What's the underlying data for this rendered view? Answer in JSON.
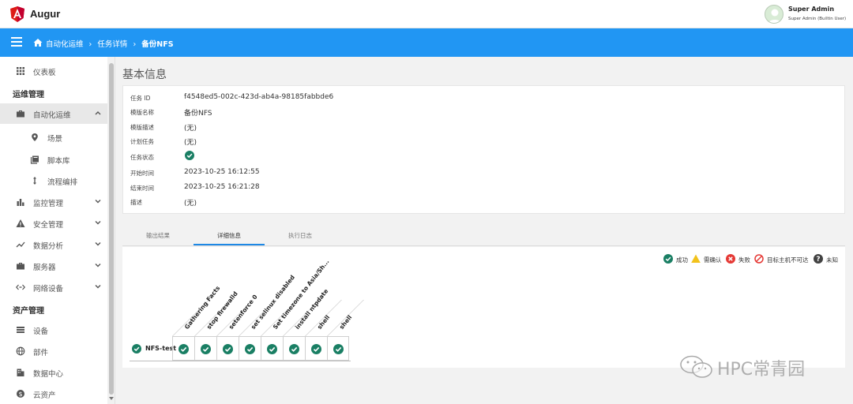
{
  "app": {
    "name": "Augur"
  },
  "user": {
    "name": "Super Admin",
    "role": "Super Admin (Builtin User)"
  },
  "breadcrumb": {
    "items": [
      "自动化运维",
      "任务详情",
      "备份NFS"
    ],
    "sep": "›"
  },
  "sidebar": {
    "dashboard": "仪表板",
    "sections": [
      "运维管理",
      "资产管理"
    ],
    "items": [
      {
        "label": "自动化运维",
        "icon": "briefcase-icon"
      },
      {
        "label": "场景",
        "icon": "location-pin-icon"
      },
      {
        "label": "脚本库",
        "icon": "book-icon"
      },
      {
        "label": "流程编排",
        "icon": "arrows-vertical-icon"
      },
      {
        "label": "监控管理",
        "icon": "bar-chart-icon"
      },
      {
        "label": "安全管理",
        "icon": "warning-icon"
      },
      {
        "label": "数据分析",
        "icon": "trend-line-icon"
      },
      {
        "label": "服务器",
        "icon": "briefcase-icon"
      },
      {
        "label": "网络设备",
        "icon": "code-arrows-icon"
      },
      {
        "label": "设备",
        "icon": "list-icon"
      },
      {
        "label": "部件",
        "icon": "globe-icon"
      },
      {
        "label": "数据中心",
        "icon": "building-icon"
      },
      {
        "label": "云资产",
        "icon": "dollar-circle-icon"
      }
    ]
  },
  "page": {
    "title": "基本信息"
  },
  "info": {
    "rows": [
      {
        "label": "任务 ID",
        "value": "f4548ed5-002c-423d-ab4a-98185fabbde6"
      },
      {
        "label": "模版名称",
        "value": "备份NFS"
      },
      {
        "label": "模版描述",
        "value": "(无)"
      },
      {
        "label": "计划任务",
        "value": "(无)"
      },
      {
        "label": "任务状态",
        "value": ""
      },
      {
        "label": "开始时间",
        "value": "2023-10-25 16:12:55"
      },
      {
        "label": "结束时间",
        "value": "2023-10-25 16:21:28"
      },
      {
        "label": "描述",
        "value": "(无)"
      }
    ],
    "status": "success"
  },
  "tabs": [
    {
      "label": "输出结果"
    },
    {
      "label": "详细信息",
      "active": true
    },
    {
      "label": "执行日志"
    }
  ],
  "legend": [
    {
      "label": "成功",
      "icon": "check-circle-icon",
      "color": "#1a7f64"
    },
    {
      "label": "需确认",
      "icon": "warning-triangle-icon",
      "color": "#f2c21b"
    },
    {
      "label": "失败",
      "icon": "x-circle-icon",
      "color": "#e53935"
    },
    {
      "label": "目标主机不可达",
      "icon": "unreachable-icon",
      "color": "#e53935"
    },
    {
      "label": "未知",
      "icon": "question-circle-icon",
      "color": "#424242"
    }
  ],
  "grid": {
    "host": "NFS-test",
    "tasks": [
      "Gathering Facts",
      "stop firewalld",
      "setenforce 0",
      "set selinux disabled",
      "Set timezone to Asia/Sh...",
      "install ntpdate",
      "shell",
      "shell"
    ],
    "statuses": [
      "success",
      "success",
      "success",
      "success",
      "success",
      "success",
      "success",
      "success"
    ]
  },
  "watermark": "HPC常青园",
  "colors": {
    "accent": "#2196f3",
    "success": "#1a7f64"
  }
}
